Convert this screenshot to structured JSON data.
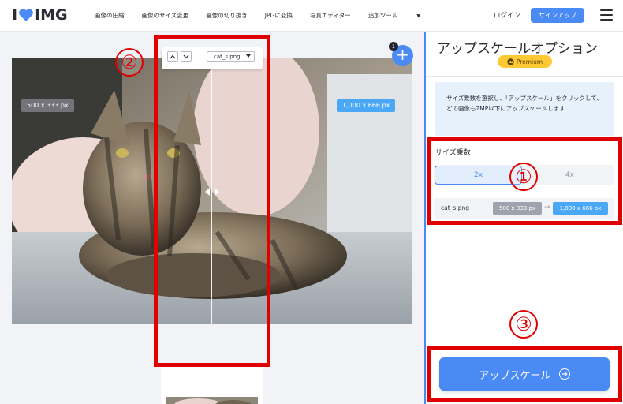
{
  "header": {
    "logo_left": "I",
    "logo_right": "IMG",
    "nav": [
      "画像の圧縮",
      "画像のサイズ変更",
      "画像の切り抜き",
      "JPGに変換",
      "写真エディター",
      "追加ツール"
    ],
    "login": "ログイン",
    "signup": "サインアップ"
  },
  "workspace": {
    "file_select": "cat_s.png",
    "badge_count": "1",
    "add_label": "+",
    "size_before": "500 x 333 px",
    "size_after": "1,000 x 666 px"
  },
  "panel": {
    "title": "アップスケールオプション",
    "premium": "Premium",
    "info": "サイズ乗数を選択し、「アップスケール」をクリックして、どの画像も2MP以下にアップスケールします",
    "scale_label": "サイズ乗数",
    "options": [
      "2x",
      "4x"
    ],
    "selected": "2x",
    "file_name": "cat_s.png",
    "old_size": "500 x 333 px",
    "new_size": "1,000 x 666 px",
    "arrow": "→",
    "button": "アップスケール"
  },
  "annotations": {
    "n1": "①",
    "n2": "②",
    "n3": "③",
    "color": "#e00000"
  },
  "colors": {
    "accent": "#4a8af4",
    "size_badge": "#4aa8f7",
    "premium": "#ffc933"
  }
}
